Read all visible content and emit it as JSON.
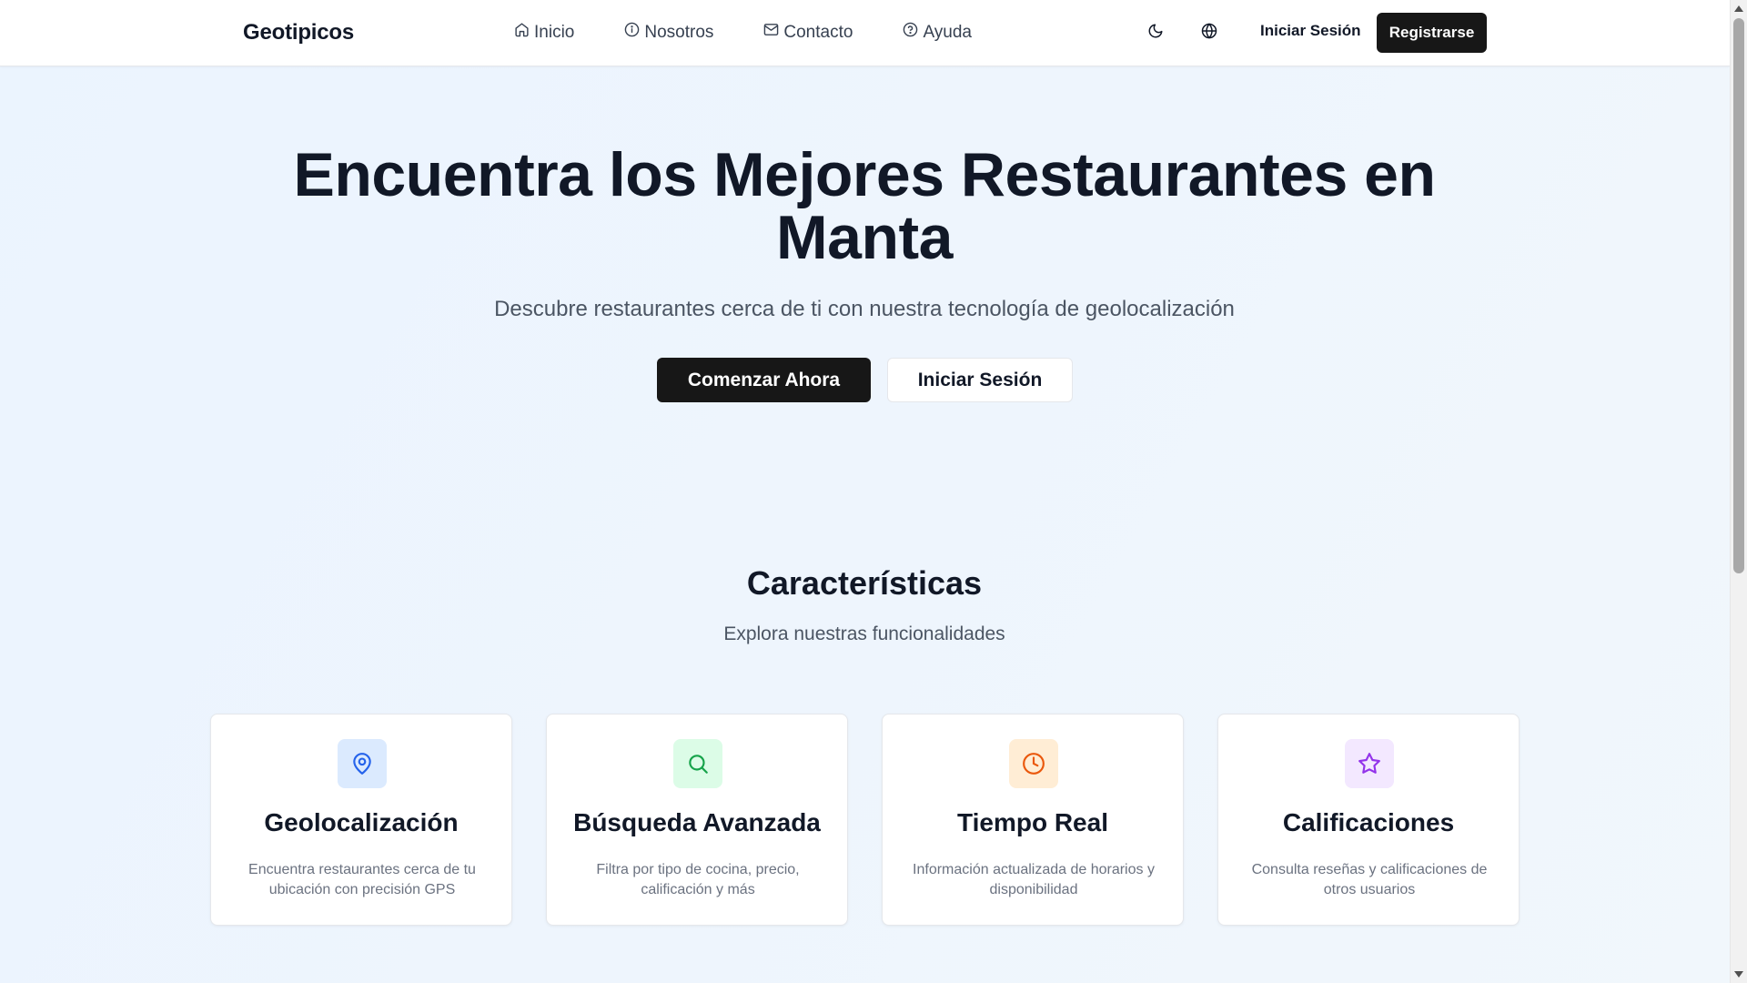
{
  "navbar": {
    "brand": "Geotipicos",
    "links": [
      {
        "label": "Inicio",
        "icon": "home-icon"
      },
      {
        "label": "Nosotros",
        "icon": "info-icon"
      },
      {
        "label": "Contacto",
        "icon": "mail-icon"
      },
      {
        "label": "Ayuda",
        "icon": "help-circle-icon"
      }
    ],
    "theme_toggle_icon": "moon-icon",
    "language_icon": "globe-icon",
    "login_label": "Iniciar Sesión",
    "register_label": "Registrarse"
  },
  "hero": {
    "title": "Encuentra los Mejores Restaurantes en Manta",
    "subtitle": "Descubre restaurantes cerca de ti con nuestra tecnología de geolocalización",
    "primary_cta": "Comenzar Ahora",
    "secondary_cta": "Iniciar Sesión"
  },
  "features": {
    "title": "Características",
    "subtitle": "Explora nuestras funcionalidades",
    "cards": [
      {
        "title": "Geolocalización",
        "description": "Encuentra restaurantes cerca de tu ubicación con precisión GPS",
        "icon": "map-pin-icon",
        "icon_color": "#2563eb",
        "icon_bg": "#dbeafe"
      },
      {
        "title": "Búsqueda Avanzada",
        "description": "Filtra por tipo de cocina, precio, calificación y más",
        "icon": "search-icon",
        "icon_color": "#16a34a",
        "icon_bg": "#dcfce7"
      },
      {
        "title": "Tiempo Real",
        "description": "Información actualizada de horarios y disponibilidad",
        "icon": "clock-icon",
        "icon_color": "#ea580c",
        "icon_bg": "#ffedd5"
      },
      {
        "title": "Calificaciones",
        "description": "Consulta reseñas y calificaciones de otros usuarios",
        "icon": "star-icon",
        "icon_color": "#9333ea",
        "icon_bg": "#f3e8ff"
      }
    ]
  },
  "colors": {
    "primary_button": "#171717",
    "text_dark": "#111827",
    "text_muted": "#4b5563"
  }
}
